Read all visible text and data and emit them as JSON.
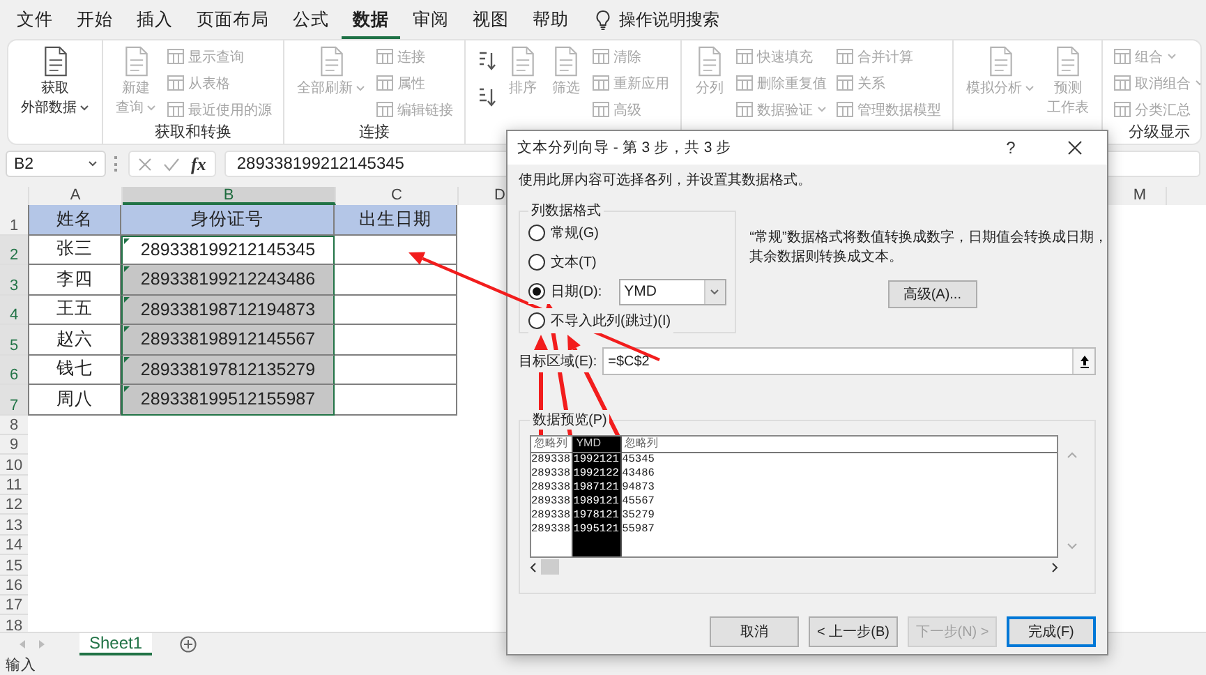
{
  "menu_tabs": [
    {
      "label": "文件",
      "selected": false
    },
    {
      "label": "开始",
      "selected": false
    },
    {
      "label": "插入",
      "selected": false
    },
    {
      "label": "页面布局",
      "selected": false
    },
    {
      "label": "公式",
      "selected": false
    },
    {
      "label": "数据",
      "selected": true
    },
    {
      "label": "审阅",
      "selected": false
    },
    {
      "label": "视图",
      "selected": false
    },
    {
      "label": "帮助",
      "selected": false
    }
  ],
  "tell_me": "操作说明搜索",
  "ribbon": {
    "groups": [
      {
        "items": [
          {
            "kind": "large",
            "lines": [
              "获取",
              "外部数据"
            ],
            "dropdown": true,
            "disabled": false
          }
        ]
      },
      {
        "label": "获取和转换",
        "items": [
          {
            "kind": "large",
            "lines": [
              "新建",
              "查询"
            ],
            "dropdown": true,
            "disabled": true
          },
          {
            "kind": "small",
            "label": "显示查询",
            "dropdown": false,
            "disabled": true
          },
          {
            "kind": "small",
            "label": "从表格",
            "dropdown": false,
            "disabled": true
          },
          {
            "kind": "small",
            "label": "最近使用的源",
            "dropdown": false,
            "disabled": true
          }
        ]
      },
      {
        "label": "连接",
        "items": [
          {
            "kind": "large",
            "lines": [
              "全部刷新"
            ],
            "dropdown": true,
            "disabled": true
          },
          {
            "kind": "small",
            "label": "连接",
            "dropdown": false,
            "disabled": true
          },
          {
            "kind": "small",
            "label": "属性",
            "dropdown": false,
            "disabled": true
          },
          {
            "kind": "small",
            "label": "编辑链接",
            "dropdown": false,
            "disabled": true
          }
        ]
      },
      {
        "items": [
          {
            "kind": "sort-ascending",
            "disabled": false
          },
          {
            "kind": "sort-descending",
            "disabled": false
          },
          {
            "kind": "large",
            "lines": [
              "排序"
            ],
            "dropdown": false,
            "disabled": true
          },
          {
            "kind": "large",
            "lines": [
              "筛选"
            ],
            "dropdown": false,
            "disabled": true
          },
          {
            "kind": "small",
            "label": "清除",
            "dropdown": false,
            "disabled": true
          },
          {
            "kind": "small",
            "label": "重新应用",
            "dropdown": false,
            "disabled": true
          },
          {
            "kind": "small",
            "label": "高级",
            "dropdown": false,
            "disabled": true
          }
        ]
      },
      {
        "items": [
          {
            "kind": "large",
            "lines": [
              "分列"
            ],
            "dropdown": false,
            "disabled": true
          },
          {
            "kind": "small",
            "label": "快速填充",
            "dropdown": false,
            "disabled": true
          },
          {
            "kind": "small",
            "label": "删除重复值",
            "dropdown": false,
            "disabled": true
          },
          {
            "kind": "small",
            "label": "数据验证",
            "dropdown": true,
            "disabled": true
          },
          {
            "kind": "small",
            "label": "合并计算",
            "dropdown": false,
            "disabled": true
          },
          {
            "kind": "small",
            "label": "关系",
            "dropdown": false,
            "disabled": true
          },
          {
            "kind": "small",
            "label": "管理数据模型",
            "dropdown": false,
            "disabled": true
          }
        ]
      },
      {
        "items": [
          {
            "kind": "large",
            "lines": [
              "模拟分析"
            ],
            "dropdown": true,
            "disabled": true
          },
          {
            "kind": "large",
            "lines": [
              "预测",
              "工作表"
            ],
            "dropdown": false,
            "disabled": true
          }
        ]
      },
      {
        "label": "分级显示",
        "items": [
          {
            "kind": "small",
            "label": "组合",
            "dropdown": true,
            "disabled": true
          },
          {
            "kind": "small",
            "label": "取消组合",
            "dropdown": true,
            "disabled": true
          },
          {
            "kind": "small",
            "label": "分类汇总",
            "dropdown": false,
            "disabled": true
          }
        ]
      }
    ]
  },
  "formula_bar": {
    "name_box": "B2",
    "function_label": "fx",
    "formula": "289338199212145345"
  },
  "sheet": {
    "columns": [
      {
        "label": "A",
        "selected": false
      },
      {
        "label": "B",
        "selected": true
      },
      {
        "label": "C",
        "selected": false
      },
      {
        "label": "D",
        "selected": false
      },
      {
        "label": "M",
        "selected": false
      }
    ],
    "row_headers": [
      {
        "label": "1",
        "selected": false
      },
      {
        "label": "2",
        "selected": true
      },
      {
        "label": "3",
        "selected": true
      },
      {
        "label": "4",
        "selected": true
      },
      {
        "label": "5",
        "selected": true
      },
      {
        "label": "6",
        "selected": true
      },
      {
        "label": "7",
        "selected": true
      },
      {
        "label": "8",
        "selected": false
      },
      {
        "label": "9",
        "selected": false
      },
      {
        "label": "10",
        "selected": false
      },
      {
        "label": "11",
        "selected": false
      },
      {
        "label": "12",
        "selected": false
      },
      {
        "label": "13",
        "selected": false
      },
      {
        "label": "14",
        "selected": false
      },
      {
        "label": "15",
        "selected": false
      },
      {
        "label": "16",
        "selected": false
      },
      {
        "label": "17",
        "selected": false
      },
      {
        "label": "18",
        "selected": false
      }
    ],
    "header": [
      "姓名",
      "身份证号",
      "出生日期"
    ],
    "rows": [
      {
        "name": "张三",
        "id_number": "289338199212145345",
        "selected": true,
        "active": true,
        "flagged": true
      },
      {
        "name": "李四",
        "id_number": "289338199212243486",
        "selected": true,
        "active": false,
        "flagged": true
      },
      {
        "name": "王五",
        "id_number": "289338198712194873",
        "selected": true,
        "active": false,
        "flagged": true
      },
      {
        "name": "赵六",
        "id_number": "289338198912145567",
        "selected": true,
        "active": false,
        "flagged": true
      },
      {
        "name": "钱七",
        "id_number": "289338197812135279",
        "selected": true,
        "active": false,
        "flagged": true
      },
      {
        "name": "周八",
        "id_number": "289338199512155987",
        "selected": true,
        "active": false,
        "flagged": true
      }
    ]
  },
  "sheet_tabs": [
    {
      "label": "Sheet1",
      "selected": true
    }
  ],
  "status_bar": {
    "mode": "输入"
  },
  "dialog": {
    "title": "文本分列向导 - 第 3 步，共 3 步",
    "help_button": "?",
    "instruction": "使用此屏内容可选择各列，并设置其数据格式。",
    "format_group": {
      "label": "列数据格式",
      "options": [
        {
          "kind": "plain",
          "label": "常规(G)",
          "selected": false
        },
        {
          "kind": "plain",
          "label": "文本(T)",
          "selected": false
        },
        {
          "kind": "with-select",
          "label": "日期(D):",
          "value": "YMD",
          "selected": true
        },
        {
          "kind": "plain",
          "label": "不导入此列(跳过)(I)",
          "selected": false
        }
      ]
    },
    "description": "“常规”数据格式将数值转换成数字，日期值会转换成日期，其余数据则转换成文本。",
    "advanced_button": "高级(A)...",
    "destination": {
      "label": "目标区域(E):",
      "value": "=$C$2"
    },
    "preview": {
      "label": "数据预览(P)",
      "columns": [
        {
          "header": "忽略列",
          "selected": false
        },
        {
          "header": "YMD",
          "selected": true
        },
        {
          "header": "忽略列",
          "selected": false
        }
      ],
      "rows": [
        [
          "289338",
          "1992121",
          "45345"
        ],
        [
          "289338",
          "1992122",
          "43486"
        ],
        [
          "289338",
          "1987121",
          "94873"
        ],
        [
          "289338",
          "1989121",
          "45567"
        ],
        [
          "289338",
          "1978121",
          "35279"
        ],
        [
          "289338",
          "1995121",
          "55987"
        ]
      ]
    },
    "buttons": [
      {
        "label": "取消",
        "disabled": false,
        "default": false
      },
      {
        "label": "< 上一步(B)",
        "disabled": false,
        "default": false
      },
      {
        "label": "下一步(N) >",
        "disabled": true,
        "default": false
      },
      {
        "label": "完成(F)",
        "disabled": false,
        "default": true
      }
    ]
  }
}
